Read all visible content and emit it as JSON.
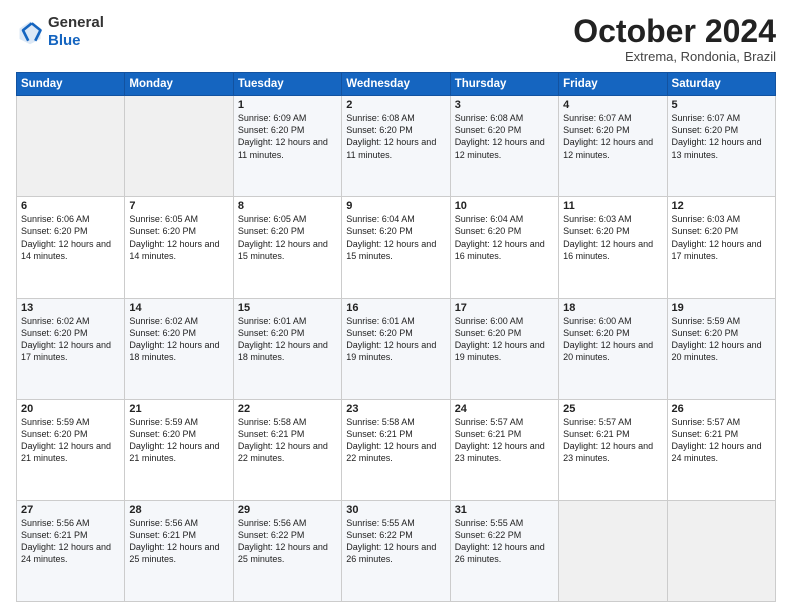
{
  "header": {
    "logo_general": "General",
    "logo_blue": "Blue",
    "month_title": "October 2024",
    "location": "Extrema, Rondonia, Brazil"
  },
  "days_of_week": [
    "Sunday",
    "Monday",
    "Tuesday",
    "Wednesday",
    "Thursday",
    "Friday",
    "Saturday"
  ],
  "weeks": [
    [
      {
        "day": "",
        "text": ""
      },
      {
        "day": "",
        "text": ""
      },
      {
        "day": "1",
        "text": "Sunrise: 6:09 AM\nSunset: 6:20 PM\nDaylight: 12 hours and 11 minutes."
      },
      {
        "day": "2",
        "text": "Sunrise: 6:08 AM\nSunset: 6:20 PM\nDaylight: 12 hours and 11 minutes."
      },
      {
        "day": "3",
        "text": "Sunrise: 6:08 AM\nSunset: 6:20 PM\nDaylight: 12 hours and 12 minutes."
      },
      {
        "day": "4",
        "text": "Sunrise: 6:07 AM\nSunset: 6:20 PM\nDaylight: 12 hours and 12 minutes."
      },
      {
        "day": "5",
        "text": "Sunrise: 6:07 AM\nSunset: 6:20 PM\nDaylight: 12 hours and 13 minutes."
      }
    ],
    [
      {
        "day": "6",
        "text": "Sunrise: 6:06 AM\nSunset: 6:20 PM\nDaylight: 12 hours and 14 minutes."
      },
      {
        "day": "7",
        "text": "Sunrise: 6:05 AM\nSunset: 6:20 PM\nDaylight: 12 hours and 14 minutes."
      },
      {
        "day": "8",
        "text": "Sunrise: 6:05 AM\nSunset: 6:20 PM\nDaylight: 12 hours and 15 minutes."
      },
      {
        "day": "9",
        "text": "Sunrise: 6:04 AM\nSunset: 6:20 PM\nDaylight: 12 hours and 15 minutes."
      },
      {
        "day": "10",
        "text": "Sunrise: 6:04 AM\nSunset: 6:20 PM\nDaylight: 12 hours and 16 minutes."
      },
      {
        "day": "11",
        "text": "Sunrise: 6:03 AM\nSunset: 6:20 PM\nDaylight: 12 hours and 16 minutes."
      },
      {
        "day": "12",
        "text": "Sunrise: 6:03 AM\nSunset: 6:20 PM\nDaylight: 12 hours and 17 minutes."
      }
    ],
    [
      {
        "day": "13",
        "text": "Sunrise: 6:02 AM\nSunset: 6:20 PM\nDaylight: 12 hours and 17 minutes."
      },
      {
        "day": "14",
        "text": "Sunrise: 6:02 AM\nSunset: 6:20 PM\nDaylight: 12 hours and 18 minutes."
      },
      {
        "day": "15",
        "text": "Sunrise: 6:01 AM\nSunset: 6:20 PM\nDaylight: 12 hours and 18 minutes."
      },
      {
        "day": "16",
        "text": "Sunrise: 6:01 AM\nSunset: 6:20 PM\nDaylight: 12 hours and 19 minutes."
      },
      {
        "day": "17",
        "text": "Sunrise: 6:00 AM\nSunset: 6:20 PM\nDaylight: 12 hours and 19 minutes."
      },
      {
        "day": "18",
        "text": "Sunrise: 6:00 AM\nSunset: 6:20 PM\nDaylight: 12 hours and 20 minutes."
      },
      {
        "day": "19",
        "text": "Sunrise: 5:59 AM\nSunset: 6:20 PM\nDaylight: 12 hours and 20 minutes."
      }
    ],
    [
      {
        "day": "20",
        "text": "Sunrise: 5:59 AM\nSunset: 6:20 PM\nDaylight: 12 hours and 21 minutes."
      },
      {
        "day": "21",
        "text": "Sunrise: 5:59 AM\nSunset: 6:20 PM\nDaylight: 12 hours and 21 minutes."
      },
      {
        "day": "22",
        "text": "Sunrise: 5:58 AM\nSunset: 6:21 PM\nDaylight: 12 hours and 22 minutes."
      },
      {
        "day": "23",
        "text": "Sunrise: 5:58 AM\nSunset: 6:21 PM\nDaylight: 12 hours and 22 minutes."
      },
      {
        "day": "24",
        "text": "Sunrise: 5:57 AM\nSunset: 6:21 PM\nDaylight: 12 hours and 23 minutes."
      },
      {
        "day": "25",
        "text": "Sunrise: 5:57 AM\nSunset: 6:21 PM\nDaylight: 12 hours and 23 minutes."
      },
      {
        "day": "26",
        "text": "Sunrise: 5:57 AM\nSunset: 6:21 PM\nDaylight: 12 hours and 24 minutes."
      }
    ],
    [
      {
        "day": "27",
        "text": "Sunrise: 5:56 AM\nSunset: 6:21 PM\nDaylight: 12 hours and 24 minutes."
      },
      {
        "day": "28",
        "text": "Sunrise: 5:56 AM\nSunset: 6:21 PM\nDaylight: 12 hours and 25 minutes."
      },
      {
        "day": "29",
        "text": "Sunrise: 5:56 AM\nSunset: 6:22 PM\nDaylight: 12 hours and 25 minutes."
      },
      {
        "day": "30",
        "text": "Sunrise: 5:55 AM\nSunset: 6:22 PM\nDaylight: 12 hours and 26 minutes."
      },
      {
        "day": "31",
        "text": "Sunrise: 5:55 AM\nSunset: 6:22 PM\nDaylight: 12 hours and 26 minutes."
      },
      {
        "day": "",
        "text": ""
      },
      {
        "day": "",
        "text": ""
      }
    ]
  ]
}
